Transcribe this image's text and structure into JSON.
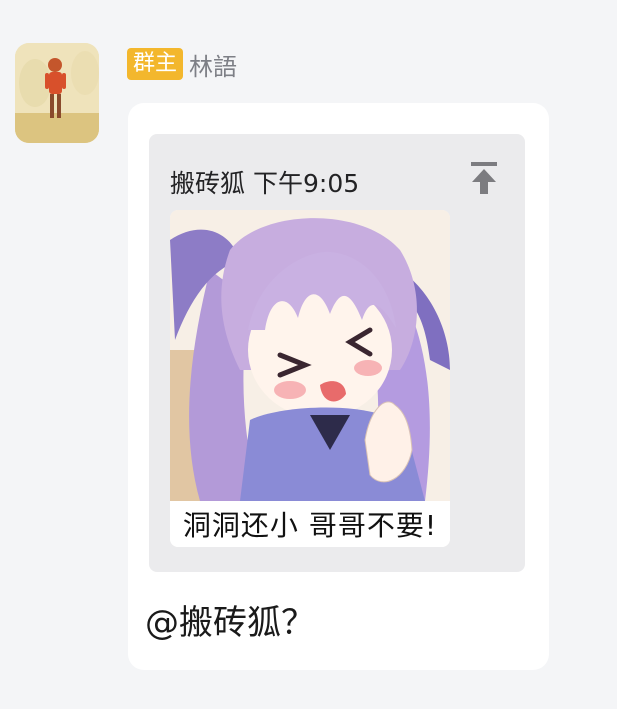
{
  "sender": {
    "role_badge": "群主",
    "name": "林語"
  },
  "message": {
    "quote": {
      "author": "搬砖狐",
      "time": "下午9:05",
      "sticker_caption": "洞洞还小  哥哥不要!"
    },
    "text": "@搬砖狐？"
  },
  "colors": {
    "badge": "#f3b72d",
    "bubble": "#ffffff",
    "quote_bg": "#ebebed",
    "background": "#f4f5f7"
  },
  "icons": {
    "jump_to_original": "arrow-to-top-icon"
  }
}
